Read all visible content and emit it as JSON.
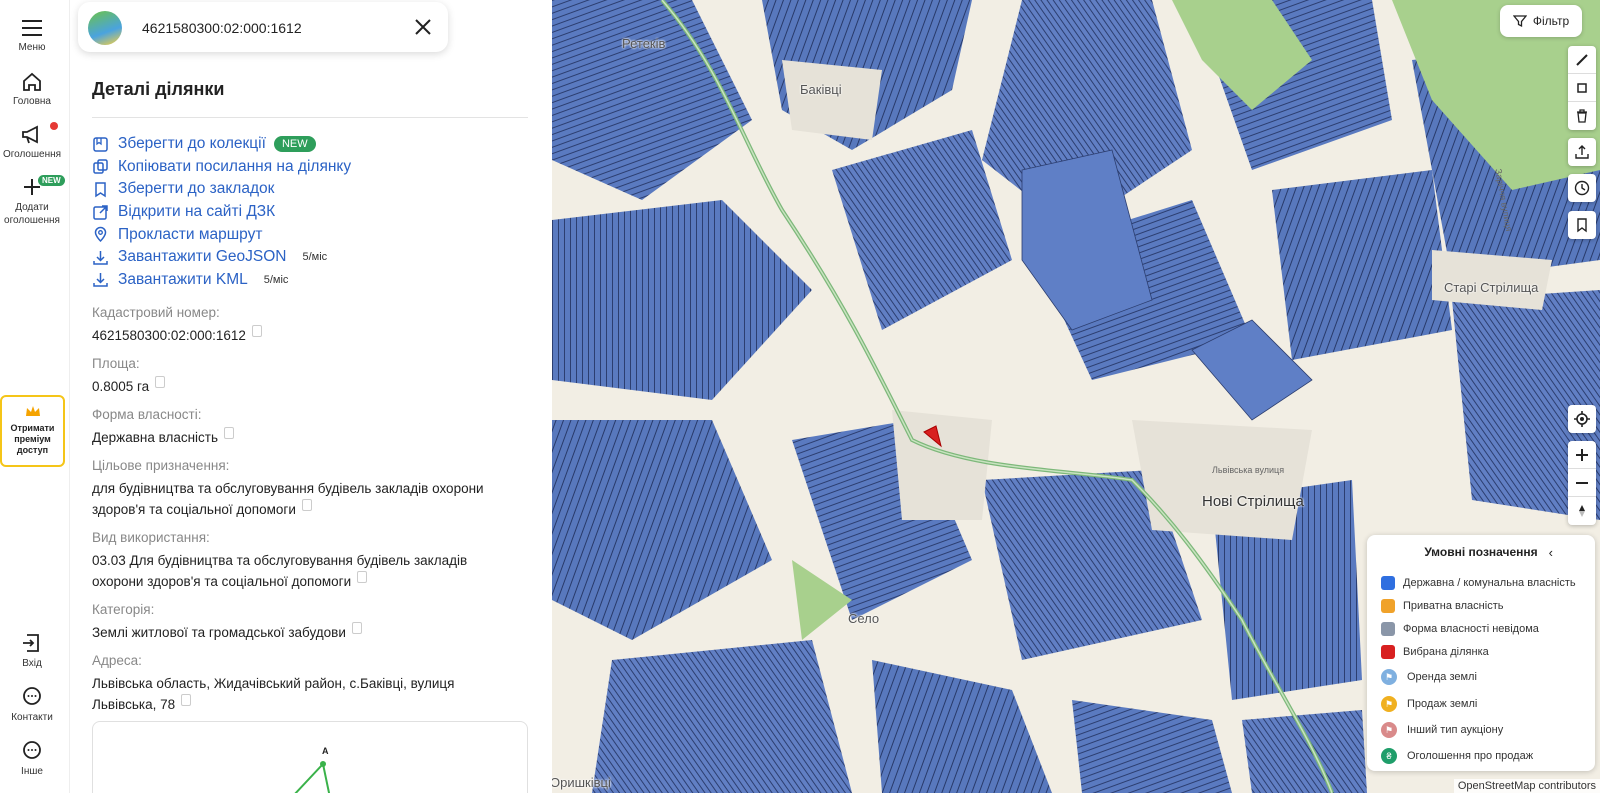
{
  "rail": {
    "menu": "Меню",
    "home": "Головна",
    "ads": "Оголошення",
    "add_line1": "Додати",
    "add_line2": "оголошення",
    "new_badge": "NEW",
    "premium_line1": "Отримати",
    "premium_line2": "преміум",
    "premium_line3": "доступ",
    "login": "Вхід",
    "contacts": "Контакти",
    "other": "Інше"
  },
  "search": {
    "query": "4621580300:02:000:1612"
  },
  "panel": {
    "title": "Деталі ділянки",
    "actions": [
      {
        "label": "Зберегти до колекції",
        "icon": "collection-icon",
        "badge": "NEW"
      },
      {
        "label": "Копіювати посилання на ділянку",
        "icon": "copy-link-icon"
      },
      {
        "label": "Зберегти до закладок",
        "icon": "bookmark-icon"
      },
      {
        "label": "Відкрити на сайті ДЗК",
        "icon": "external-link-icon"
      },
      {
        "label": "Прокласти маршрут",
        "icon": "location-pin-icon"
      },
      {
        "label": "Завантажити GeoJSON",
        "icon": "download-icon",
        "quota": "5/міс"
      },
      {
        "label": "Завантажити KML",
        "icon": "download-icon",
        "quota": "5/міс"
      }
    ],
    "fields": [
      {
        "label": "Кадастровий номер:",
        "value": "4621580300:02:000:1612"
      },
      {
        "label": "Площа:",
        "value": "0.8005 га"
      },
      {
        "label": "Форма власності:",
        "value": "Державна власність"
      },
      {
        "label": "Цільове призначення:",
        "value": "для будівництва та обслуговування будівель закладів охорони здоров'я та соціальної допомоги"
      },
      {
        "label": "Вид використання:",
        "value": "03.03 Для будівництва та обслуговування будівель закладів охорони здоров'я та соціальної допомоги"
      },
      {
        "label": "Категорія:",
        "value": "Землі житлової та громадської забудови"
      },
      {
        "label": "Адреса:",
        "value": "Львівська область, Жидачівський район, с.Баківці, вулиця Львівська, 78"
      }
    ],
    "vertex_label": "A"
  },
  "map": {
    "filter": "Фільтр",
    "labels": {
      "novi": "Нові Стрілища",
      "stari": "Старі Стрілища",
      "bakivtsi": "Баківці",
      "selo": "Село",
      "top": "Ретеків",
      "bottom": "Оришківці",
      "road1": "Львівська вулиця",
      "road2": "Заріччя вулиця"
    },
    "legend": {
      "title": "Умовні позначення",
      "items": [
        {
          "label": "Державна / комунальна власність",
          "color": "#2f6fe0"
        },
        {
          "label": "Приватна власність",
          "color": "#f0a22a"
        },
        {
          "label": "Форма власності невідома",
          "color": "#8a96a8"
        },
        {
          "label": "Вибрана ділянка",
          "color": "#d82020"
        }
      ],
      "markers": [
        {
          "label": "Оренда землі",
          "color": "#7fb0e0"
        },
        {
          "label": "Продаж землі",
          "color": "#f0b020"
        },
        {
          "label": "Інший тип аукціону",
          "color": "#d98a8a"
        },
        {
          "label": "Оголошення про продаж",
          "color": "#1f9e6a"
        }
      ]
    },
    "attribution": "OpenStreetMap contributors"
  }
}
